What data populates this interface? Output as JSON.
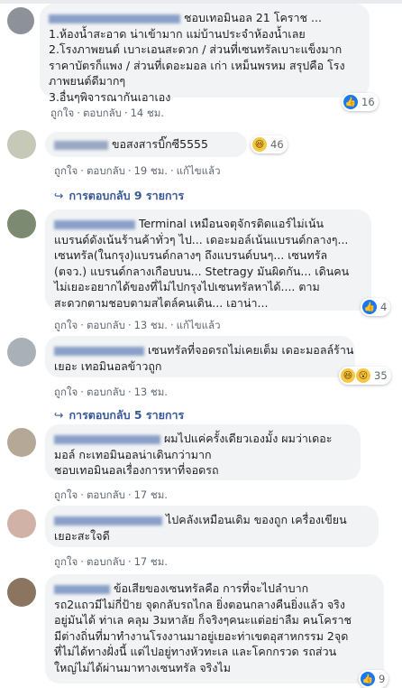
{
  "actions": {
    "like": "ถูกใจ",
    "reply": "ตอบกลับ",
    "edited": "แก้ไขแล้ว"
  },
  "comments": [
    {
      "name": "",
      "lines": [
        "ชอบเทอมินอล 21 โคราช ...",
        "1.ห้องน้ำสะอาด น่าเข้ามาก แม่บ้านประจำห้องน้ำเลย",
        "2.โรงภาพยนต์ เบาะเอนสะดวก / ส่วนที่เซนทรัลเบาะแข็งมาก",
        "ราคาบัตรก็แพง / ส่วนที่เดอะมอล เก่า เหม็นพรหม สรุปคือ โรง",
        "ภาพยนต์ดีมากๆ",
        "3.อื่นๆพิจารณากันเอาเอง"
      ],
      "time": "14 ชม.",
      "reaction_count": "16",
      "edited": false
    },
    {
      "name": "",
      "lines": [
        "ขอสงสารบิ๊กซี5555"
      ],
      "time": "19 ชม.",
      "reaction_count": "46",
      "edited": true,
      "replies": "การตอบกลับ 9 รายการ"
    },
    {
      "name": "",
      "lines": [
        "Terminal เหมือนจตุจักรติดแอร์ไม่เน้น",
        "แบรนด์ดังเน้นร้านค้าทั่วๆ ไป... เดอะมอล์เน้นแบรนด์กลางๆ...",
        "เซนทรัล(ในกรุง)แบรนด์กลางๆ ถึงแบรนด์บนๆ... เซนทรัล",
        "(ตจว.) แบรนด์กลางเกือบบน... Stetragy มันผิดกัน... เดินคน",
        "ไม่เยอะอยากได้ของที่ไม่ไปกรุงไปเซนทรัลหาได้.... ตาม",
        "สะดวกตามชอบตามสไตล์คนเดิน... เอาน่า..."
      ],
      "time": "13 ชม.",
      "reaction_count": "4",
      "edited": true
    },
    {
      "name": "",
      "lines": [
        "เซนทรัลที่จอดรถไม่เคยเต็ม เดอะมอลล์ร้าน",
        "เยอะ เทอมินอลข้าวถูก"
      ],
      "time": "13 ชม.",
      "reaction_count": "35",
      "edited": false,
      "replies": "การตอบกลับ 5 รายการ"
    },
    {
      "name": "",
      "lines": [
        "ผมไปแค่ครั้งเดียวเองมั้ง ผมว่าเดอะ",
        "มอล์ กะเทอมินอลน่าเดินกว่ามาก",
        "ชอบเทอมินอลเรื่องการหาที่จอดรถ"
      ],
      "time": "17 ชม.",
      "reaction_count": "",
      "edited": false
    },
    {
      "name": "",
      "lines": [
        "ไปคลังเหมือนเดิม ของถูก เครื่องเขียน",
        "เยอะสะใจดี"
      ],
      "time": "17 ชม.",
      "reaction_count": "",
      "edited": false
    },
    {
      "name": "",
      "lines": [
        "ข้อเสียของเซนทรัลคือ การที่จะไปลำบาก",
        "รถ2แถวมีไม่กี่ป้าย จุดกลับรถไกล ยิ่งตอนกลางคืนยิ่งแล้ว จริง",
        "อยู่มันได้ ท่าเล คลุม 3มหาลัย ก็จริงๆคนะแต่อย่าลืม คนโคราช",
        "มีต่างถิ่นที่มาทำงานโรงงานมาอยู่เยอะท่าเขตอุสาหกรรม 2จุด",
        "ที่ไม่ได้ทางฝั่งนี้ แต่ไปอยู่ทางหัวทะเล และโคกกรวด รถส่วน",
        "ใหญ่ไม่ได้ผ่านมาทางเซนทรัล จริงไม"
      ],
      "time": "",
      "reaction_count": "9",
      "edited": false
    }
  ]
}
